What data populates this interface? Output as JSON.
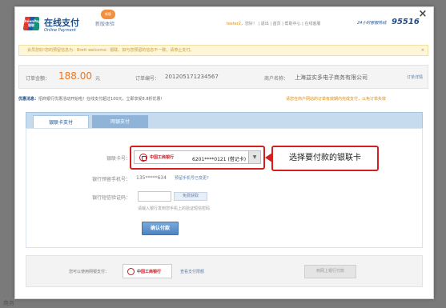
{
  "header": {
    "logo_text": "UnionPay 银联",
    "title": "在线支付",
    "subtitle": "Online Payment",
    "beta_label": "新版体验",
    "beta_badge": "新版",
    "user": "tester2",
    "toplinks": "，您好！  |  退出  |  首页  |  帮助中心  |  在线客服",
    "hotline_label": "24小时客服热线",
    "hotline_number": "95516",
    "close_glyph": "×"
  },
  "notice": {
    "text": "会员您好!您的预留信息为：Brett welcome：银联，如与您预留的信息不一致，请停止支付。",
    "close_glyph": "×"
  },
  "order": {
    "amount_label": "订单金额：",
    "amount": "188.00",
    "currency": "元",
    "order_no_label": "订单编号：",
    "order_no": "201205171234567",
    "merchant_label": "商户名称：",
    "merchant": "上海益实多电子商务有限公司",
    "details_link": "订单详情"
  },
  "promo": {
    "prefix": "优惠消息：",
    "text": "招商银行优惠活动开始啦！在线支付超过100元，立即享受8.8折优惠！",
    "right_text": "请您在商户网站的订单有效期内完成支付，以免订单失效"
  },
  "tabs": [
    {
      "label": "银联卡支付"
    },
    {
      "label": "网银支付"
    }
  ],
  "form": {
    "card_label": "银联卡号：",
    "bank_name": "中国工商银行",
    "card_value": "6201****0121 (借记卡)",
    "phone_label": "银行预留手机号：",
    "phone_value": "135*****634",
    "phone_link": "预留手机号已变更?",
    "sms_label": "银行短信验证码：",
    "sms_button": "免费获取",
    "sms_hint": "请输入银行发到您手机上的验证短信密码",
    "confirm_button": "确认付款"
  },
  "callout": {
    "text": "选择要付款的银联卡"
  },
  "other_payment": {
    "label": "您可以使用网银支付：",
    "bank_name": "中国工商银行",
    "limit_link": "查看支付限额",
    "online_button": "到网上银行付款"
  },
  "background": {
    "ghost_text": "商务"
  }
}
